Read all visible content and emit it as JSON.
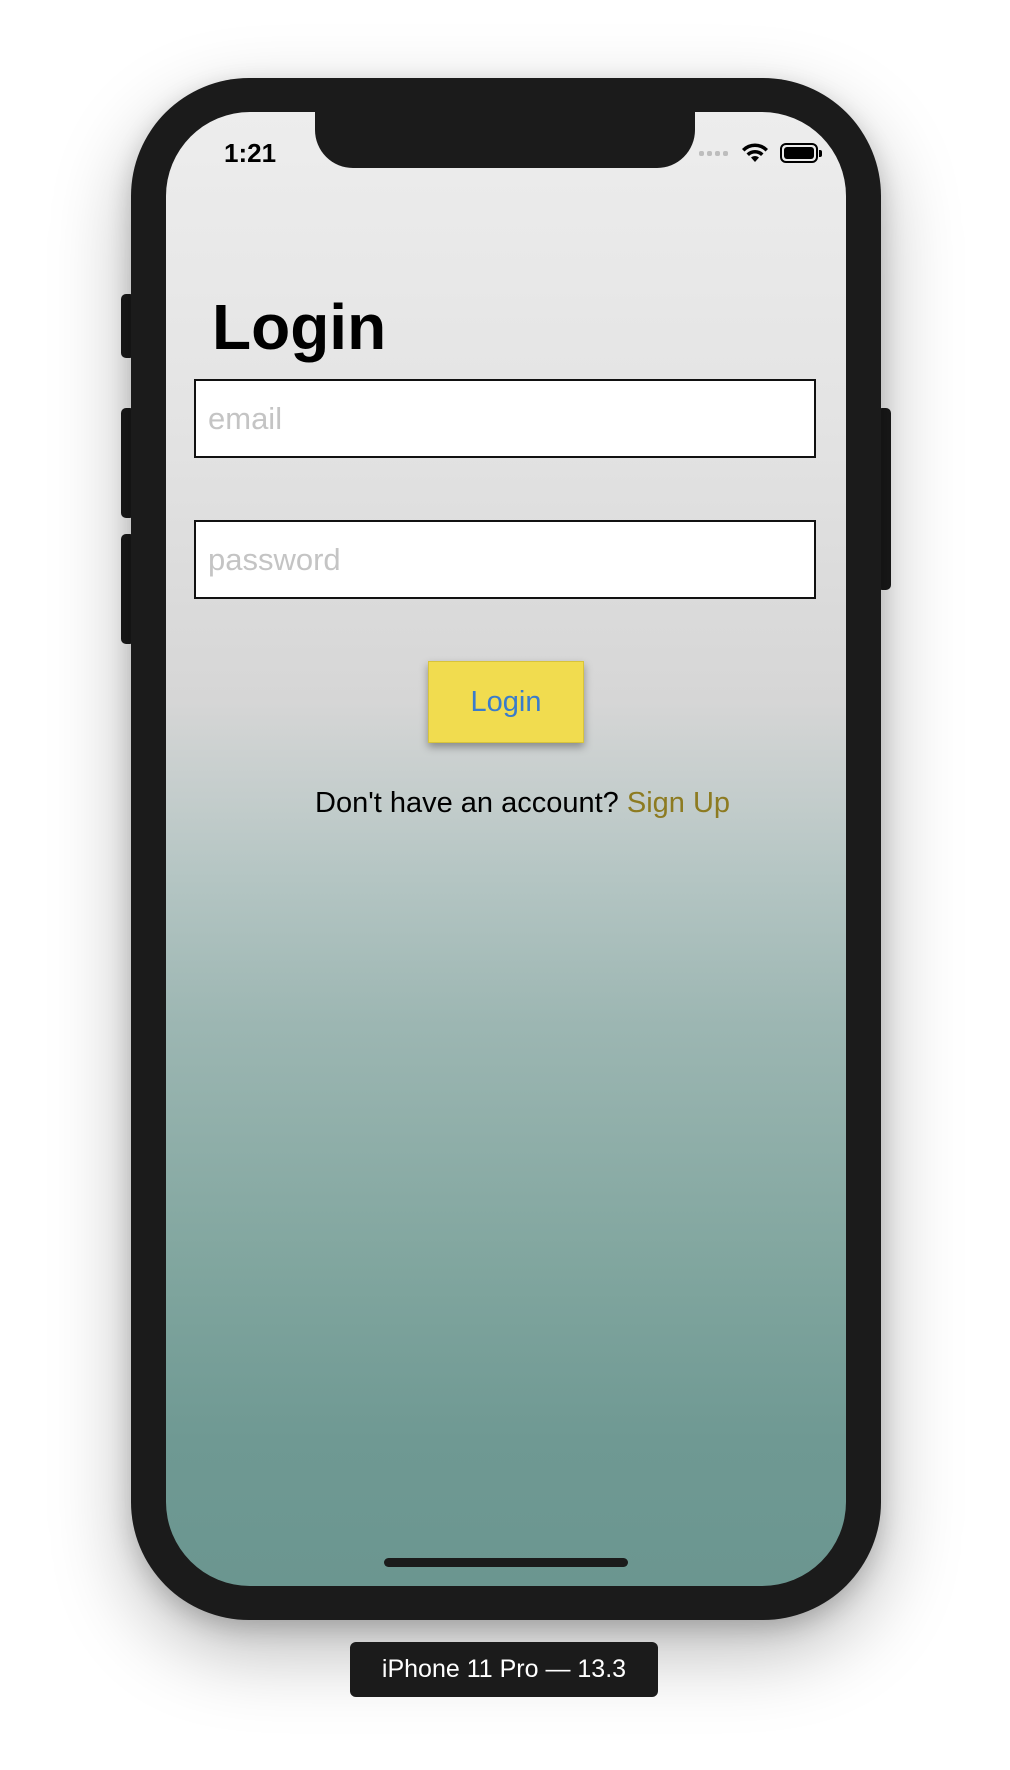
{
  "status_bar": {
    "time": "1:21"
  },
  "login_screen": {
    "title": "Login",
    "email_placeholder": "email",
    "password_placeholder": "password",
    "login_button_label": "Login",
    "signup_prompt": "Don't have an account?",
    "signup_link_label": "Sign Up"
  },
  "simulator": {
    "device_label": "iPhone 11 Pro — 13.3"
  },
  "colors": {
    "login_button_bg": "#f1dc4f",
    "login_button_text": "#3a7ccb",
    "signup_link": "#8d7b21",
    "gradient_top": "#ededed",
    "gradient_bottom": "#6b9690"
  },
  "icons": {
    "signal": "cellular-signal-icon",
    "wifi": "wifi-icon",
    "battery": "battery-icon"
  }
}
